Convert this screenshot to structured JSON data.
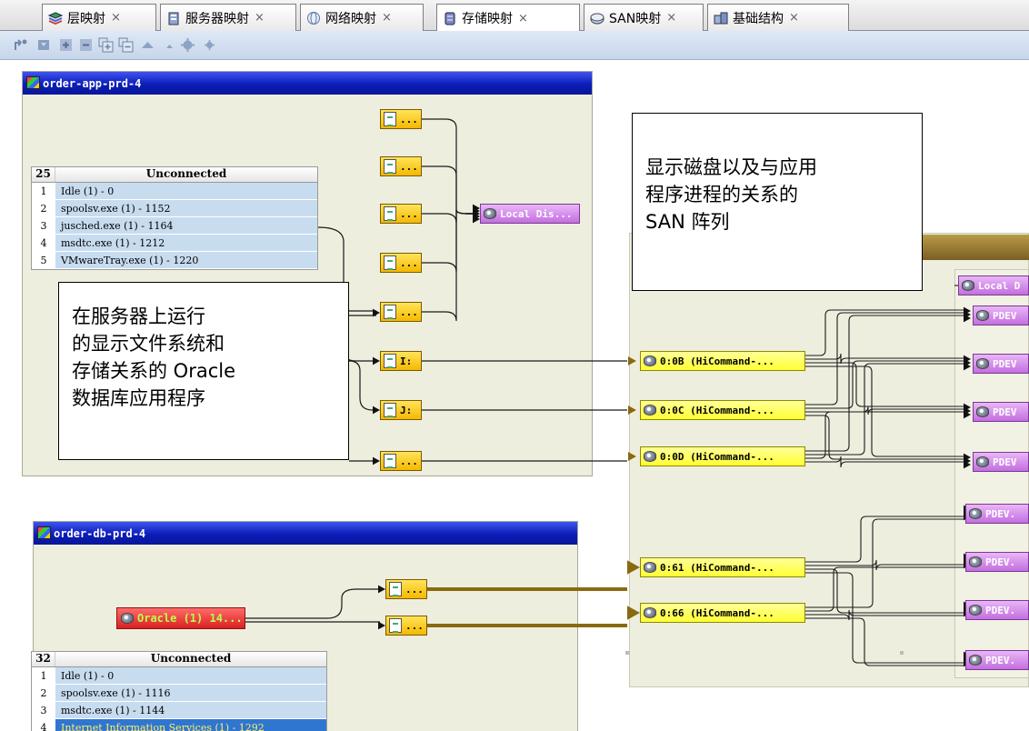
{
  "tabs": [
    {
      "label": "层映射",
      "icon": "layers-icon"
    },
    {
      "label": "服务器映射",
      "icon": "server-icon"
    },
    {
      "label": "网络映射",
      "icon": "network-icon"
    },
    {
      "label": "存储映射",
      "icon": "storage-icon",
      "active": true
    },
    {
      "label": "SAN映射",
      "icon": "san-icon"
    },
    {
      "label": "基础结构",
      "icon": "infrastructure-icon"
    }
  ],
  "tab_close_glyph": "×",
  "toolbar_icons": [
    "layout-icon",
    "filter-icon",
    "expand-all-icon",
    "collapse-all-icon",
    "expand-icon",
    "collapse-icon",
    "move-up-icon",
    "move-up-small-icon",
    "zoom-icon",
    "zoom-small-icon"
  ],
  "panels": {
    "app": {
      "title": "order-app-prd-4",
      "unconnected": {
        "count": "25",
        "header": "Unconnected",
        "rows": [
          {
            "n": "1",
            "name": "Idle (1) - 0"
          },
          {
            "n": "2",
            "name": "spoolsv.exe (1) - 1152"
          },
          {
            "n": "3",
            "name": "jusched.exe (1) - 1164"
          },
          {
            "n": "4",
            "name": "msdtc.exe (1) - 1212"
          },
          {
            "n": "5",
            "name": "VMwareTray.exe (1) - 1220"
          }
        ]
      },
      "filesystems": [
        "...",
        "...",
        "...",
        "...",
        "...",
        "I:",
        "J:",
        "..."
      ],
      "local_disk": "Local Dis..."
    },
    "db": {
      "title": "order-db-prd-4",
      "process": "Oracle (1) 14...",
      "filesystems": [
        "...",
        "..."
      ],
      "unconnected": {
        "count": "32",
        "header": "Unconnected",
        "rows": [
          {
            "n": "1",
            "name": "Idle (1) - 0"
          },
          {
            "n": "2",
            "name": "spoolsv.exe (1) - 1116"
          },
          {
            "n": "3",
            "name": "msdtc.exe (1) - 1144"
          },
          {
            "n": "4",
            "name": "Internet Information Services (1) - 1292",
            "selected": true
          }
        ]
      }
    }
  },
  "volumes": [
    "0:0B (HiCommand-...",
    "0:0C (HiCommand-...",
    "0:0D (HiCommand-...",
    "0:61 (HiCommand-...",
    "0:66 (HiCommand-..."
  ],
  "pdevs": [
    "Local D",
    "PDEV",
    "PDEV",
    "PDEV",
    "PDEV",
    "PDEV.",
    "PDEV.",
    "PDEV.",
    "PDEV."
  ],
  "callouts": {
    "app": [
      "在服务器上运行",
      "的显示文件系统和",
      "存储关系的 Oracle",
      "数据库应用程序"
    ],
    "san": [
      "显示磁盘以及与应用",
      "程序进程的关系的",
      "SAN 阵列"
    ]
  },
  "colors": {
    "title_bar": "#0c1db8",
    "filesystem": "#f5b800",
    "volume": "#ffff33",
    "pdev": "#c36ee0",
    "process": "#d92020",
    "wire": "#7a5a00"
  }
}
